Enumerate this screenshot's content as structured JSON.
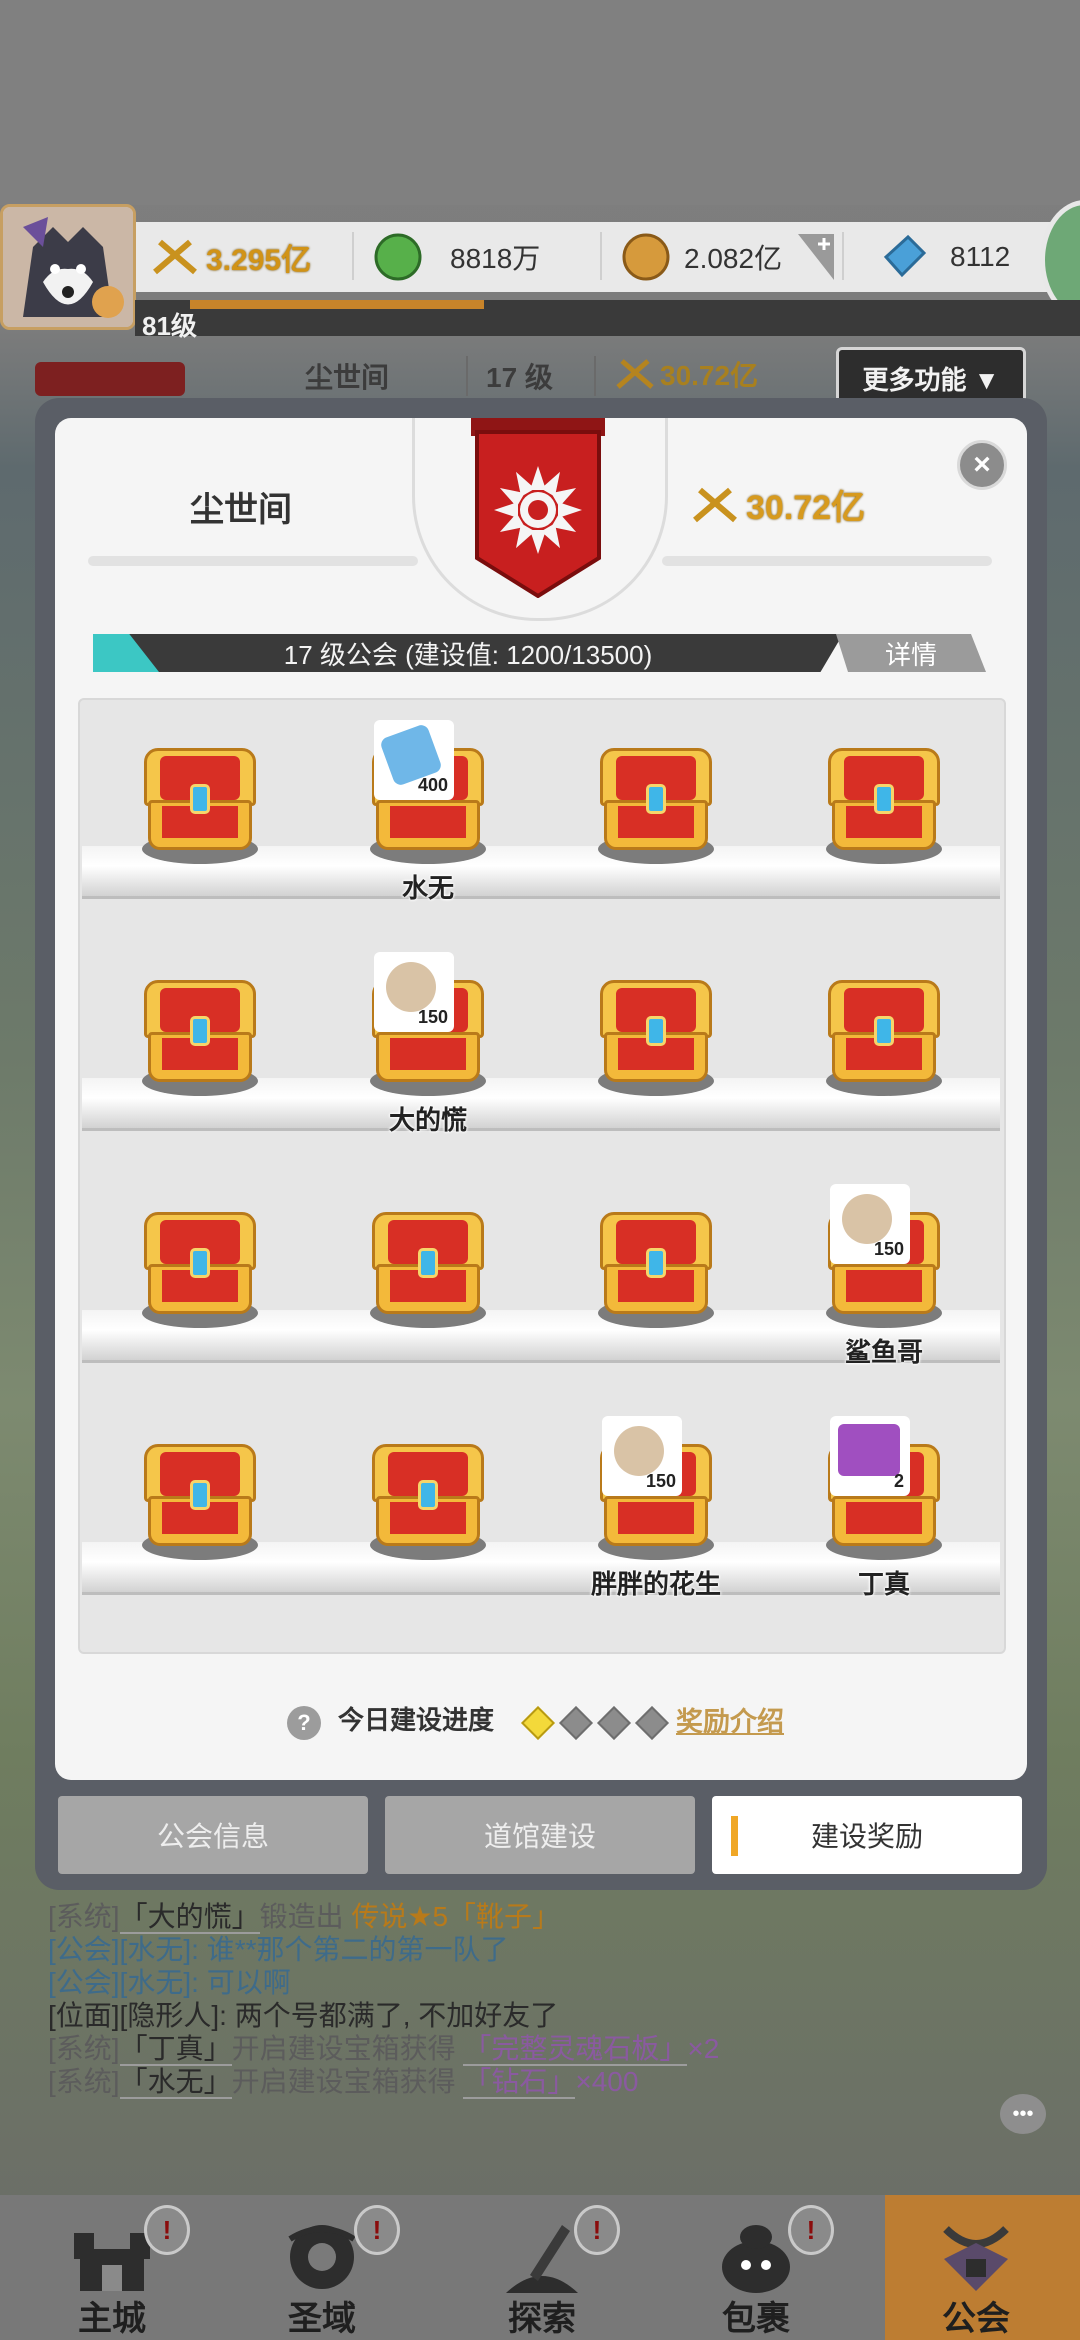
{
  "topbar": {
    "power": "3.295亿",
    "jade": "8818万",
    "gold": "2.082亿",
    "diamond": "8112",
    "level": "81级",
    "level_progress": 0.33
  },
  "guild_header": {
    "name": "尘世间",
    "level": "17 级",
    "power": "30.72亿",
    "more_label": "更多功能 ▼"
  },
  "panel": {
    "guild_name": "尘世间",
    "guild_power": "30.72亿",
    "progress_text": "17 级公会 (建设值:  1200/13500)",
    "progress_value": 0.089,
    "detail_label": "详情",
    "close_label": "×"
  },
  "chests": [
    [
      {
        "opened": false
      },
      {
        "opened": true,
        "item": "diamond-icon",
        "qty": "400",
        "owner": "水无"
      },
      {
        "opened": false
      },
      {
        "opened": false
      }
    ],
    [
      {
        "opened": false
      },
      {
        "opened": true,
        "item": "coin-icon",
        "qty": "150",
        "owner": "大的慌"
      },
      {
        "opened": false
      },
      {
        "opened": false
      }
    ],
    [
      {
        "opened": false
      },
      {
        "opened": false
      },
      {
        "opened": false
      },
      {
        "opened": true,
        "item": "coin-icon",
        "qty": "150",
        "owner": "鲨鱼哥"
      }
    ],
    [
      {
        "opened": false
      },
      {
        "opened": false
      },
      {
        "opened": true,
        "item": "coin-icon",
        "qty": "150",
        "owner": "胖胖的花生"
      },
      {
        "opened": true,
        "item": "soul-stone-icon",
        "qty": "2",
        "owner": "丁真"
      }
    ]
  ],
  "today": {
    "label": "今日建设进度",
    "help": "?",
    "progress_done": 1,
    "progress_total": 4,
    "reward_link": "奖励介绍"
  },
  "tabs": [
    {
      "label": "公会信息",
      "active": false
    },
    {
      "label": "道馆建设",
      "active": false
    },
    {
      "label": "建设奖励",
      "active": true
    }
  ],
  "chat": [
    {
      "parts": [
        {
          "t": "[系统]",
          "c": "sys"
        },
        {
          "t": "「大的慌」",
          "c": "nm box"
        },
        {
          "t": "锻造出 ",
          "c": "sys"
        },
        {
          "t": "传说★5「靴子」",
          "c": "orange"
        }
      ]
    },
    {
      "parts": [
        {
          "t": "[公会][水无]: ",
          "c": "gu"
        },
        {
          "t": "谁**那个第二的第一队了",
          "c": "gu"
        }
      ]
    },
    {
      "parts": [
        {
          "t": "[公会][水无]: ",
          "c": "gu"
        },
        {
          "t": "可以啊",
          "c": "gu"
        }
      ]
    },
    {
      "parts": [
        {
          "t": "[位面][隐形人]: ",
          "c": "pos"
        },
        {
          "t": "两个号都满了, 不加好友了",
          "c": "pos"
        }
      ]
    },
    {
      "parts": [
        {
          "t": "[系统]",
          "c": "sys"
        },
        {
          "t": "「丁真」",
          "c": "nm box"
        },
        {
          "t": "开启建设宝箱获得 ",
          "c": "sys"
        },
        {
          "t": "「完整灵魂石板」",
          "c": "purple box"
        },
        {
          "t": "×2",
          "c": "purple"
        }
      ]
    },
    {
      "parts": [
        {
          "t": "[系统]",
          "c": "sys"
        },
        {
          "t": "「水无」",
          "c": "nm box"
        },
        {
          "t": "开启建设宝箱获得 ",
          "c": "sys"
        },
        {
          "t": "「钻石」",
          "c": "purple box"
        },
        {
          "t": "×400",
          "c": "purple"
        }
      ]
    }
  ],
  "nav": [
    {
      "label": "主城",
      "icon": "castle-icon",
      "badge": "!"
    },
    {
      "label": "圣域",
      "icon": "vortex-icon",
      "badge": "!"
    },
    {
      "label": "探索",
      "icon": "sword-stone-icon",
      "badge": "!"
    },
    {
      "label": "包裹",
      "icon": "bag-icon",
      "badge": "!"
    },
    {
      "label": "公会",
      "icon": "guild-icon",
      "badge": ""
    }
  ],
  "colors": {
    "accent_gold": "#d79a1e",
    "progress_teal": "#3cc7c4",
    "chest_red": "#d82f25",
    "chest_gold": "#f5c64a",
    "active_tab_marker": "#f0a726"
  }
}
